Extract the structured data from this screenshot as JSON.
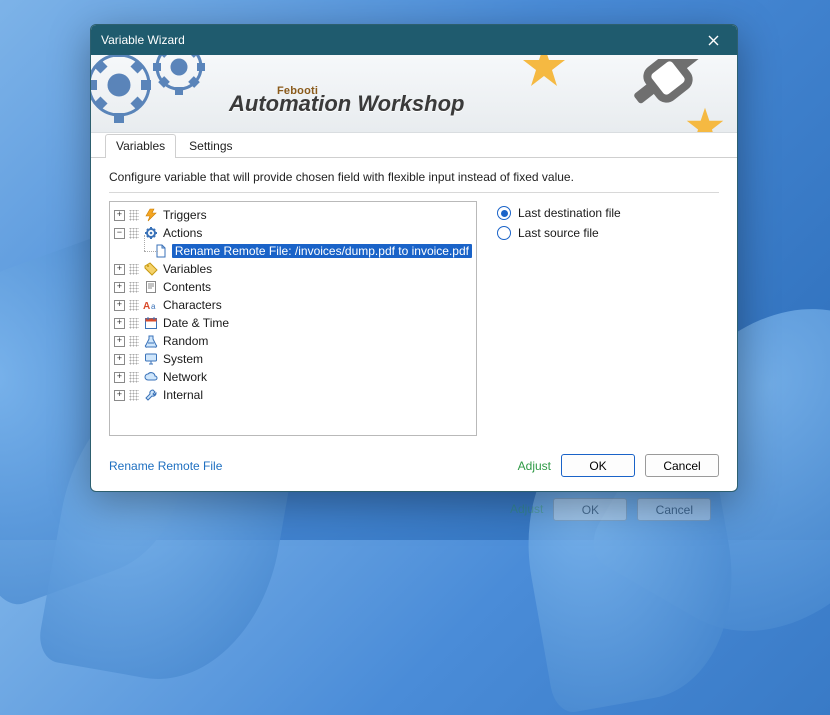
{
  "window": {
    "title": "Variable Wizard"
  },
  "banner": {
    "company": "Febooti",
    "product": "Automation Workshop"
  },
  "tabs": {
    "variables": "Variables",
    "settings": "Settings"
  },
  "instruction": "Configure variable that will provide chosen field with flexible input instead of fixed value.",
  "tree": {
    "triggers": "Triggers",
    "actions": "Actions",
    "actions_child": "Rename Remote File: /invoices/dump.pdf to invoice.pdf",
    "variables": "Variables",
    "contents": "Contents",
    "characters": "Characters",
    "datetime": "Date & Time",
    "random": "Random",
    "system": "System",
    "network": "Network",
    "internal": "Internal"
  },
  "radios": {
    "last_dest": "Last destination file",
    "last_src": "Last source file"
  },
  "footer": {
    "status": "Rename Remote File",
    "adjust": "Adjust",
    "ok": "OK",
    "cancel": "Cancel"
  },
  "ghost": {
    "adjust": "Adjust",
    "ok": "OK",
    "cancel": "Cancel"
  }
}
